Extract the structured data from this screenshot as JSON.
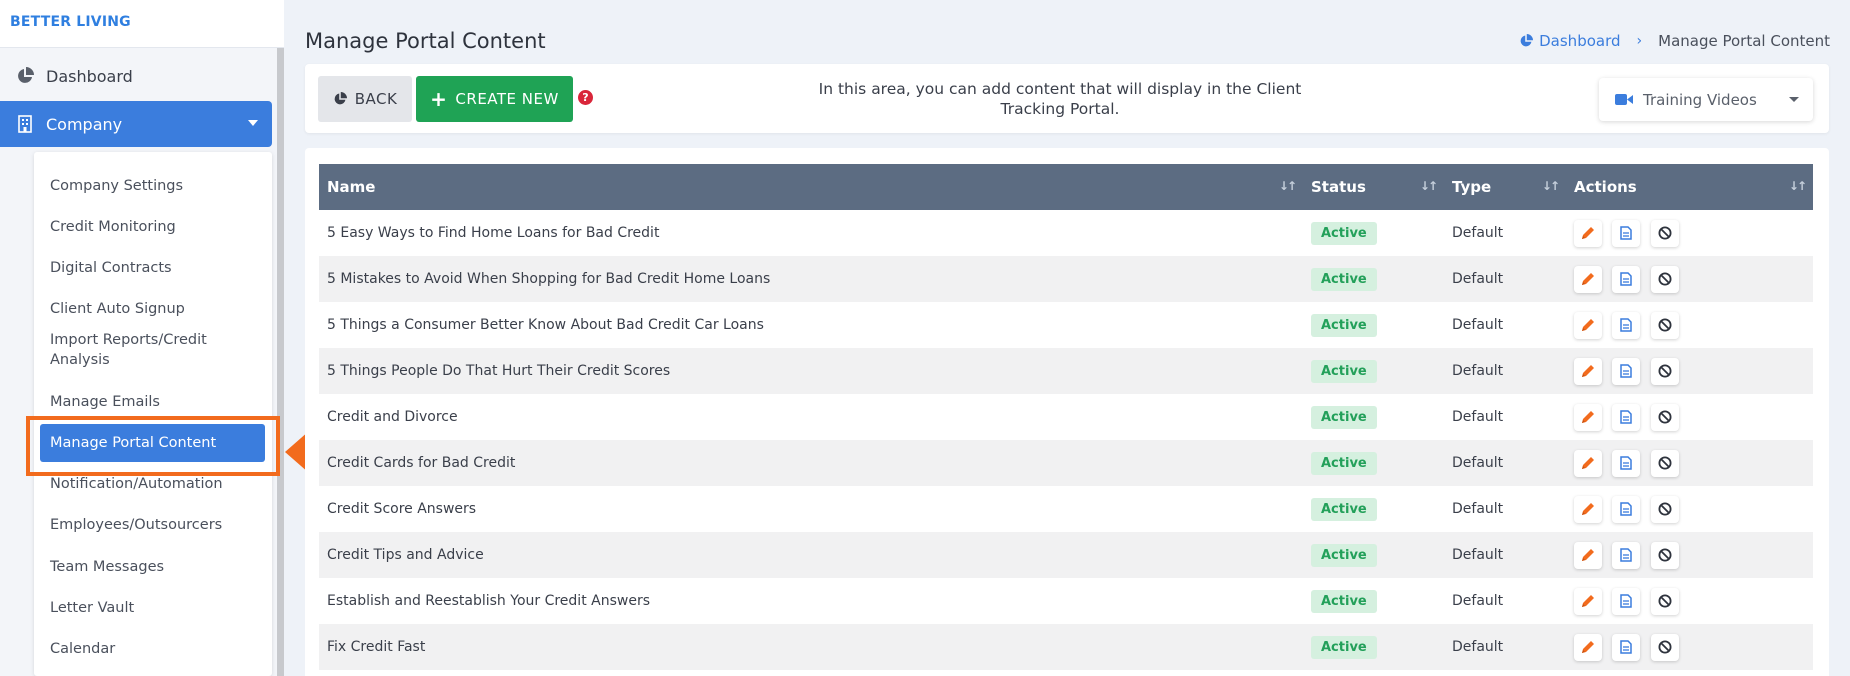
{
  "brand": "BETTER LIVING",
  "sidebar": {
    "dashboard_label": "Dashboard",
    "company_label": "Company",
    "submenu": [
      "Company Settings",
      "Credit Monitoring",
      "Digital Contracts",
      "Client Auto Signup",
      "Import Reports/Credit Analysis",
      "Manage Emails",
      "Manage Portal Content",
      "Notification/Automation",
      "Employees/Outsourcers",
      "Team Messages",
      "Letter Vault",
      "Calendar"
    ]
  },
  "header": {
    "title": "Manage Portal Content",
    "breadcrumb_home": "Dashboard",
    "breadcrumb_current": "Manage Portal Content"
  },
  "toolbar": {
    "back_label": "BACK",
    "create_label": "CREATE NEW",
    "help_glyph": "?",
    "info_text": "In this area, you can add content that will display in the Client Tracking Portal.",
    "dropdown_value": "Training Videos"
  },
  "table": {
    "columns": [
      "Name",
      "Status",
      "Type",
      "Actions"
    ],
    "rows": [
      {
        "name": "5 Easy Ways to Find Home Loans for Bad Credit",
        "status": "Active",
        "type": "Default"
      },
      {
        "name": "5 Mistakes to Avoid When Shopping for Bad Credit Home Loans",
        "status": "Active",
        "type": "Default"
      },
      {
        "name": "5 Things a Consumer Better Know About Bad Credit Car Loans",
        "status": "Active",
        "type": "Default"
      },
      {
        "name": "5 Things People Do That Hurt Their Credit Scores",
        "status": "Active",
        "type": "Default"
      },
      {
        "name": "Credit and Divorce",
        "status": "Active",
        "type": "Default"
      },
      {
        "name": "Credit Cards for Bad Credit",
        "status": "Active",
        "type": "Default"
      },
      {
        "name": "Credit Score Answers",
        "status": "Active",
        "type": "Default"
      },
      {
        "name": "Credit Tips and Advice",
        "status": "Active",
        "type": "Default"
      },
      {
        "name": "Establish and Reestablish Your Credit Answers",
        "status": "Active",
        "type": "Default"
      },
      {
        "name": "Fix Credit Fast",
        "status": "Active",
        "type": "Default"
      }
    ]
  },
  "colors": {
    "primary": "#3b7ddd",
    "success": "#1fa355",
    "header_bg": "#5c6c82",
    "highlight": "#f26b1d",
    "edit_icon": "#f26b1d"
  }
}
